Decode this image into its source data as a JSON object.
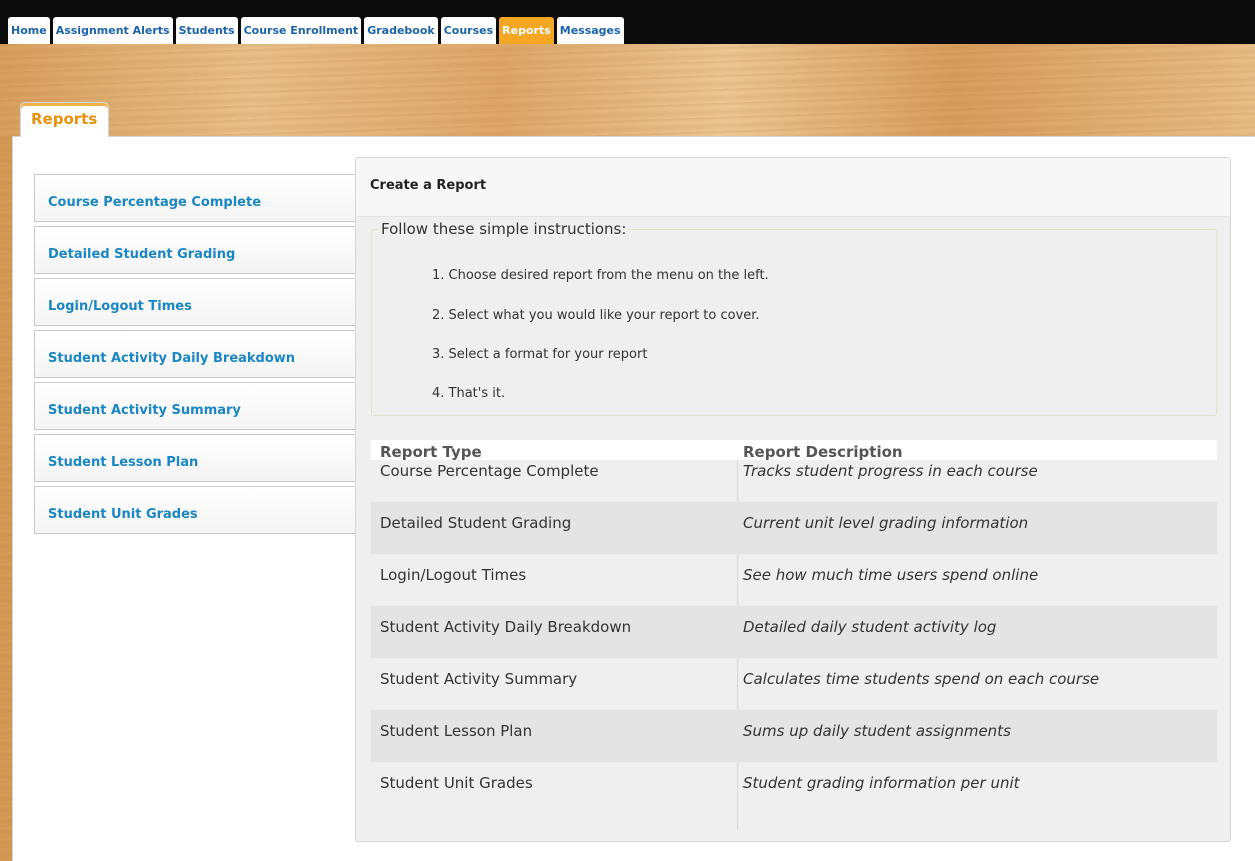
{
  "nav": {
    "tabs": [
      {
        "label": "Home",
        "active": false
      },
      {
        "label": "Assignment Alerts",
        "active": false
      },
      {
        "label": "Students",
        "active": false
      },
      {
        "label": "Course Enrollment",
        "active": false
      },
      {
        "label": "Gradebook",
        "active": false
      },
      {
        "label": "Courses",
        "active": false
      },
      {
        "label": "Reports",
        "active": true
      },
      {
        "label": "Messages",
        "active": false
      }
    ]
  },
  "section_tab": "Reports",
  "sidebar": {
    "items": [
      "Course Percentage Complete",
      "Detailed Student Grading",
      "Login/Logout Times",
      "Student Activity Daily Breakdown",
      "Student Activity Summary",
      "Student Lesson Plan",
      "Student Unit Grades"
    ]
  },
  "panel": {
    "title": "Create a Report",
    "instructions_legend": "Follow these simple instructions:",
    "steps": [
      "1.  Choose desired report from the menu on the left.",
      "2.  Select what you would like your report to cover.",
      "3.  Select a format for your report",
      "4.  That's it."
    ],
    "table": {
      "headers": [
        "Report Type",
        "Report Description"
      ],
      "rows": [
        {
          "type": "Course Percentage Complete",
          "description": "Tracks student progress in each course"
        },
        {
          "type": "Detailed Student Grading",
          "description": "Current unit level grading information"
        },
        {
          "type": "Login/Logout Times",
          "description": "See how much time users spend online"
        },
        {
          "type": "Student Activity Daily Breakdown",
          "description": "Detailed daily student activity log"
        },
        {
          "type": "Student Activity Summary",
          "description": "Calculates time students spend on each course"
        },
        {
          "type": "Student Lesson Plan",
          "description": "Sums up daily student assignments"
        },
        {
          "type": "Student Unit Grades",
          "description": "Student grading information per unit"
        }
      ]
    }
  },
  "colors": {
    "accent_orange": "#f5a623",
    "link_blue": "#1a86c4",
    "nav_blue": "#1b63a8"
  }
}
